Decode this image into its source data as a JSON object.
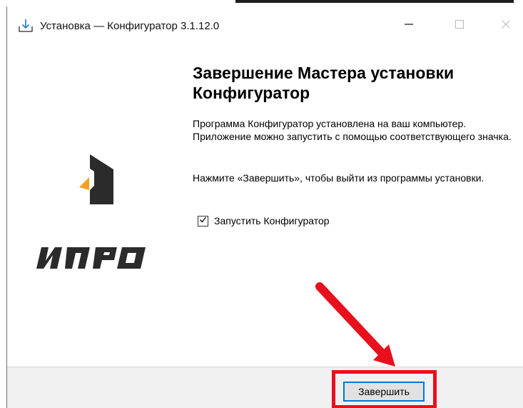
{
  "window": {
    "title": "Установка — Конфигуратор 3.1.12.0",
    "icon": "install-download-icon",
    "controls": [
      "minimize-icon",
      "maximize-icon",
      "close-icon"
    ]
  },
  "banner": {
    "logo_text": "ИПРО",
    "logo_icon": "house-logo-icon"
  },
  "content": {
    "heading": "Завершение Мастера установки Конфигуратор",
    "paragraph1": "Программа Конфигуратор установлена на ваш компьютер. Приложение можно запустить с помощью соответствующего значка.",
    "paragraph2": "Нажмите «Завершить», чтобы выйти из программы установки.",
    "launch_checkbox": {
      "label": "Запустить Конфигуратор",
      "checked": true
    }
  },
  "footer": {
    "finish_label": "Завершить"
  },
  "colors": {
    "highlight": "#e8101c",
    "arrow": "#e8101c",
    "button_focus": "#0078d7",
    "logo_dark": "#2b2b2b",
    "logo_accent": "#f5a01e"
  }
}
